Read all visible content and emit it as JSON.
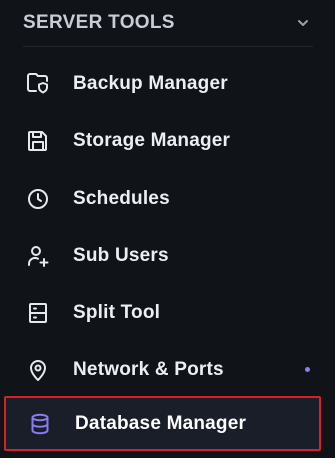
{
  "section": {
    "title": "SERVER TOOLS",
    "expand_icon": "chevron-down-icon"
  },
  "colors": {
    "background": "#101317",
    "text": "#eceef4",
    "accent": "#8b7cf6",
    "active_border": "#d8202a",
    "active_bg": "#1a1e29"
  },
  "nav": {
    "items": [
      {
        "label": "Backup Manager",
        "icon": "folder-shield-icon"
      },
      {
        "label": "Storage Manager",
        "icon": "floppy-disk-icon"
      },
      {
        "label": "Schedules",
        "icon": "clock-icon"
      },
      {
        "label": "Sub Users",
        "icon": "user-plus-icon"
      },
      {
        "label": "Split Tool",
        "icon": "server-split-icon"
      },
      {
        "label": "Network & Ports",
        "icon": "map-pin-icon",
        "indicator": "dot"
      },
      {
        "label": "Database Manager",
        "icon": "database-icon",
        "active": true
      }
    ]
  }
}
